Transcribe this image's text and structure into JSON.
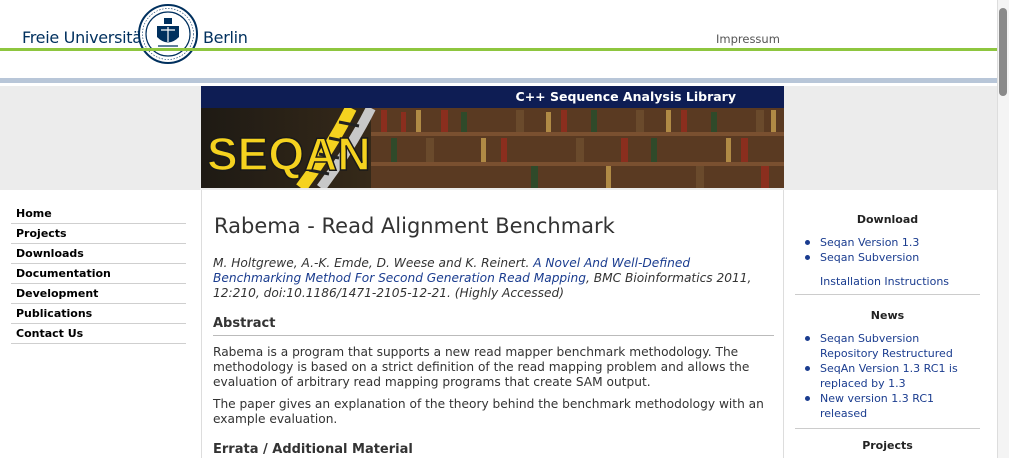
{
  "header": {
    "brand_left": "Freie Universität",
    "brand_right": "Berlin",
    "impressum": "Impressum"
  },
  "banner": {
    "title": "C++ Sequence Analysis Library",
    "logo_text": "SEQAN"
  },
  "nav": {
    "items": [
      "Home",
      "Projects",
      "Downloads",
      "Documentation",
      "Development",
      "Publications",
      "Contact Us"
    ]
  },
  "main": {
    "title": "Rabema - Read Alignment Benchmark",
    "citation": {
      "authors": "M. Holtgrewe, A.-K. Emde, D. Weese and K. Reinert.",
      "paper_link": "A Novel And Well-Defined Benchmarking Method For Second Generation Read Mapping",
      "rest": ", BMC Bioinformatics 2011, 12:210, doi:10.1186/1471-2105-12-21. (Highly Accessed)"
    },
    "abstract_heading": "Abstract",
    "abstract_p1": "Rabema is a program that supports a new read mapper benchmark methodology. The methodology is based on a strict definition of the read mapping problem and allows the evaluation of arbitrary read mapping programs that create SAM output.",
    "abstract_p2": "The paper gives an explanation of the theory behind the benchmark methodology with an example evaluation.",
    "errata_heading": "Errata / Additional Material"
  },
  "sidebar": {
    "download_heading": "Download",
    "download_items": [
      "Seqan Version 1.3",
      "Seqan Subversion"
    ],
    "install_link": "Installation Instructions",
    "news_heading": "News",
    "news_items": [
      "Seqan Subversion Repository Restructured",
      "SeqAn Version 1.3 RC1 is replaced by 1.3",
      "New version 1.3 RC1 released"
    ],
    "projects_heading": "Projects"
  },
  "colors": {
    "fu_blue": "#00305e",
    "green_line": "#8ec63f",
    "banner_navy": "#0e1d54",
    "link_blue": "#1a3c8f",
    "logo_yellow": "#f5d21f"
  }
}
